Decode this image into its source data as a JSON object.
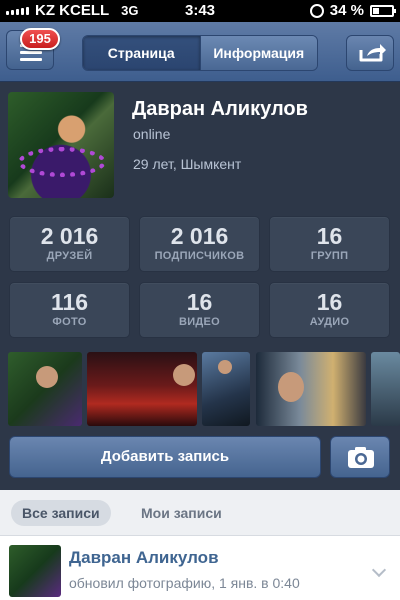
{
  "status_bar": {
    "carrier": "KZ KCELL",
    "network": "3G",
    "time": "3:43",
    "battery": "34 %",
    "battery_level": 0.34
  },
  "nav": {
    "badge_count": "195",
    "tabs": [
      {
        "label": "Страница",
        "active": true
      },
      {
        "label": "Информация",
        "active": false
      }
    ]
  },
  "profile": {
    "name": "Давран Аликулов",
    "status": "online",
    "meta": "29 лет, Шымкент"
  },
  "stats": [
    {
      "value": "2 016",
      "label": "ДРУЗЕЙ"
    },
    {
      "value": "2 016",
      "label": "ПОДПИСЧИКОВ"
    },
    {
      "value": "16",
      "label": "ГРУПП"
    },
    {
      "value": "116",
      "label": "ФОТО"
    },
    {
      "value": "16",
      "label": "ВИДЕО"
    },
    {
      "value": "16",
      "label": "АУДИО"
    }
  ],
  "actions": {
    "add_post": "Добавить запись"
  },
  "filters": {
    "all": "Все записи",
    "mine": "Мои записи"
  },
  "post": {
    "author": "Давран Аликулов",
    "text": "обновил фотографию, 1 янв. в 0:40"
  },
  "colors": {
    "nav_blue": "#4a6894",
    "link_blue": "#3f6591",
    "badge_red": "#d92a2a",
    "profile_bg": "#2d3748"
  }
}
